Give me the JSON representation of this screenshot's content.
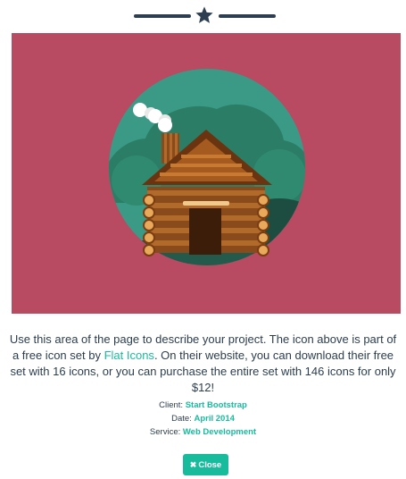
{
  "colors": {
    "primary": "#2c3e50",
    "accent": "#18bc9c",
    "hero_background": "#b84a62",
    "circle": "#3a9a86"
  },
  "divider": {
    "icon": "star-icon"
  },
  "hero": {
    "image": "log-cabin-icon"
  },
  "description": {
    "text_before_link": "Use this area of the page to describe your project. The icon above is part of a free icon set by ",
    "link_text": "Flat Icons",
    "text_after_link": ". On their website, you can download their free set with 16 icons, or you can purchase the entire set with 146 icons for only $12!"
  },
  "details": {
    "client_label": "Client:",
    "client_value": "Start Bootstrap",
    "date_label": "Date:",
    "date_value": "April 2014",
    "service_label": "Service:",
    "service_value": "Web Development"
  },
  "close_button": {
    "label": "Close",
    "icon": "times-icon"
  }
}
